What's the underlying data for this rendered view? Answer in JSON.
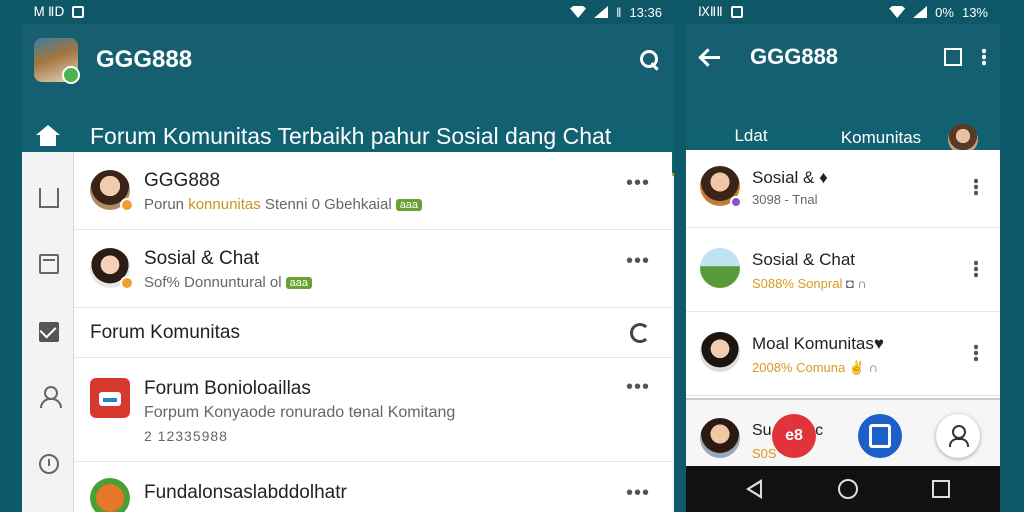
{
  "left": {
    "statusbar": {
      "left_text": "Ꮇ ⅡⅮ",
      "time": "13:36",
      "battery": "‖"
    },
    "appbar": {
      "title": "GGG888",
      "banner": "Forum Komunitas Terbaikh pahur Sosial dang Chat"
    },
    "feed": [
      {
        "title": "GGG888",
        "sub_pre": "Porun ",
        "sub_hl": "konnunitas",
        "sub_post": " Stenni  0 Gbehkaial",
        "tag": "aaa"
      },
      {
        "title": "Sosial & Chat",
        "sub_pre": "Sof%  Donnuntural ",
        "sub_hl": "",
        "sub_post": "ol",
        "tag": "aaa"
      }
    ],
    "section_header": "Forum Komunitas",
    "item3": {
      "title": "Forum Bonioloaillas",
      "sub": "Forpum Konyaode ronurado tɵnal Komitang",
      "num": "2 12335988"
    },
    "item4": {
      "title": "Fundalonsaslabddolhatr"
    }
  },
  "right": {
    "statusbar": {
      "left_text": "ⅨⅡⅡ",
      "time": "13%",
      "battery": "0%"
    },
    "appbar": {
      "title": "GGG888"
    },
    "tabs": [
      "Ldat",
      "Komunitas"
    ],
    "list": [
      {
        "title": "Sosial & ♦",
        "sub_pre": "3098 - Tnal",
        "sub_hl": ""
      },
      {
        "title": "Sosial & Chat",
        "sub_pre": "",
        "sub_hl": "S088% Sonpral",
        "sub_post": " ◘ ∩"
      },
      {
        "title": "Moal Komunitas♥",
        "sub_pre": "",
        "sub_hl": "2008% Comuna",
        "sub_post": " ✌ ∩"
      }
    ],
    "bottom": {
      "title": "Su ahionc",
      "sub": "S0S"
    },
    "fab_red_label": "e8"
  }
}
